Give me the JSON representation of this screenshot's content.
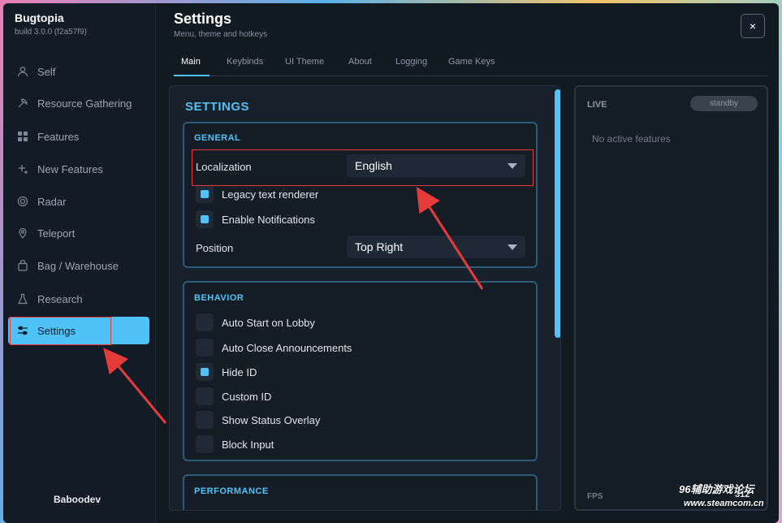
{
  "app": {
    "name": "Bugtopia",
    "build": "build 3.0.0 (f2a57f9)"
  },
  "sidebar": {
    "items": [
      {
        "label": "Self",
        "icon": "user-icon"
      },
      {
        "label": "Resource Gathering",
        "icon": "pickaxe-icon"
      },
      {
        "label": "Features",
        "icon": "grid-icon"
      },
      {
        "label": "New Features",
        "icon": "sparkle-icon"
      },
      {
        "label": "Radar",
        "icon": "radar-icon"
      },
      {
        "label": "Teleport",
        "icon": "pin-icon"
      },
      {
        "label": "Bag / Warehouse",
        "icon": "bag-icon"
      },
      {
        "label": "Research",
        "icon": "flask-icon"
      },
      {
        "label": "Settings",
        "icon": "sliders-icon",
        "active": true
      }
    ],
    "user": "Baboodev"
  },
  "header": {
    "title": "Settings",
    "subtitle": "Menu, theme and hotkeys",
    "close_label": "×"
  },
  "tabs": [
    "Main",
    "Keybinds",
    "UI Theme",
    "About",
    "Logging",
    "Game Keys"
  ],
  "panel": {
    "title": "SETTINGS",
    "general": {
      "title": "GENERAL",
      "localization_label": "Localization",
      "localization_value": "English",
      "legacy_label": "Legacy text renderer",
      "legacy_checked": true,
      "notifications_label": "Enable Notifications",
      "notifications_checked": true,
      "position_label": "Position",
      "position_value": "Top Right"
    },
    "behavior": {
      "title": "BEHAVIOR",
      "items": [
        {
          "label": "Auto Start on Lobby",
          "checked": false
        },
        {
          "label": "Auto Close Announcements",
          "checked": false
        },
        {
          "label": "Hide ID",
          "checked": true
        },
        {
          "label": "Custom ID",
          "checked": false
        },
        {
          "label": "Show Status Overlay",
          "checked": false
        },
        {
          "label": "Block Input",
          "checked": false
        }
      ]
    },
    "performance": {
      "title": "PERFORMANCE"
    }
  },
  "live": {
    "title": "LIVE",
    "status": "standby",
    "empty": "No active features",
    "fps_label": "FPS",
    "fps_value": "312"
  },
  "watermark": {
    "line1": "96辅助游戏论坛",
    "line2": "www.steamcom.cn"
  },
  "colors": {
    "accent": "#4fc3f7",
    "background": "#111921",
    "annotation": "#e53b3b"
  }
}
